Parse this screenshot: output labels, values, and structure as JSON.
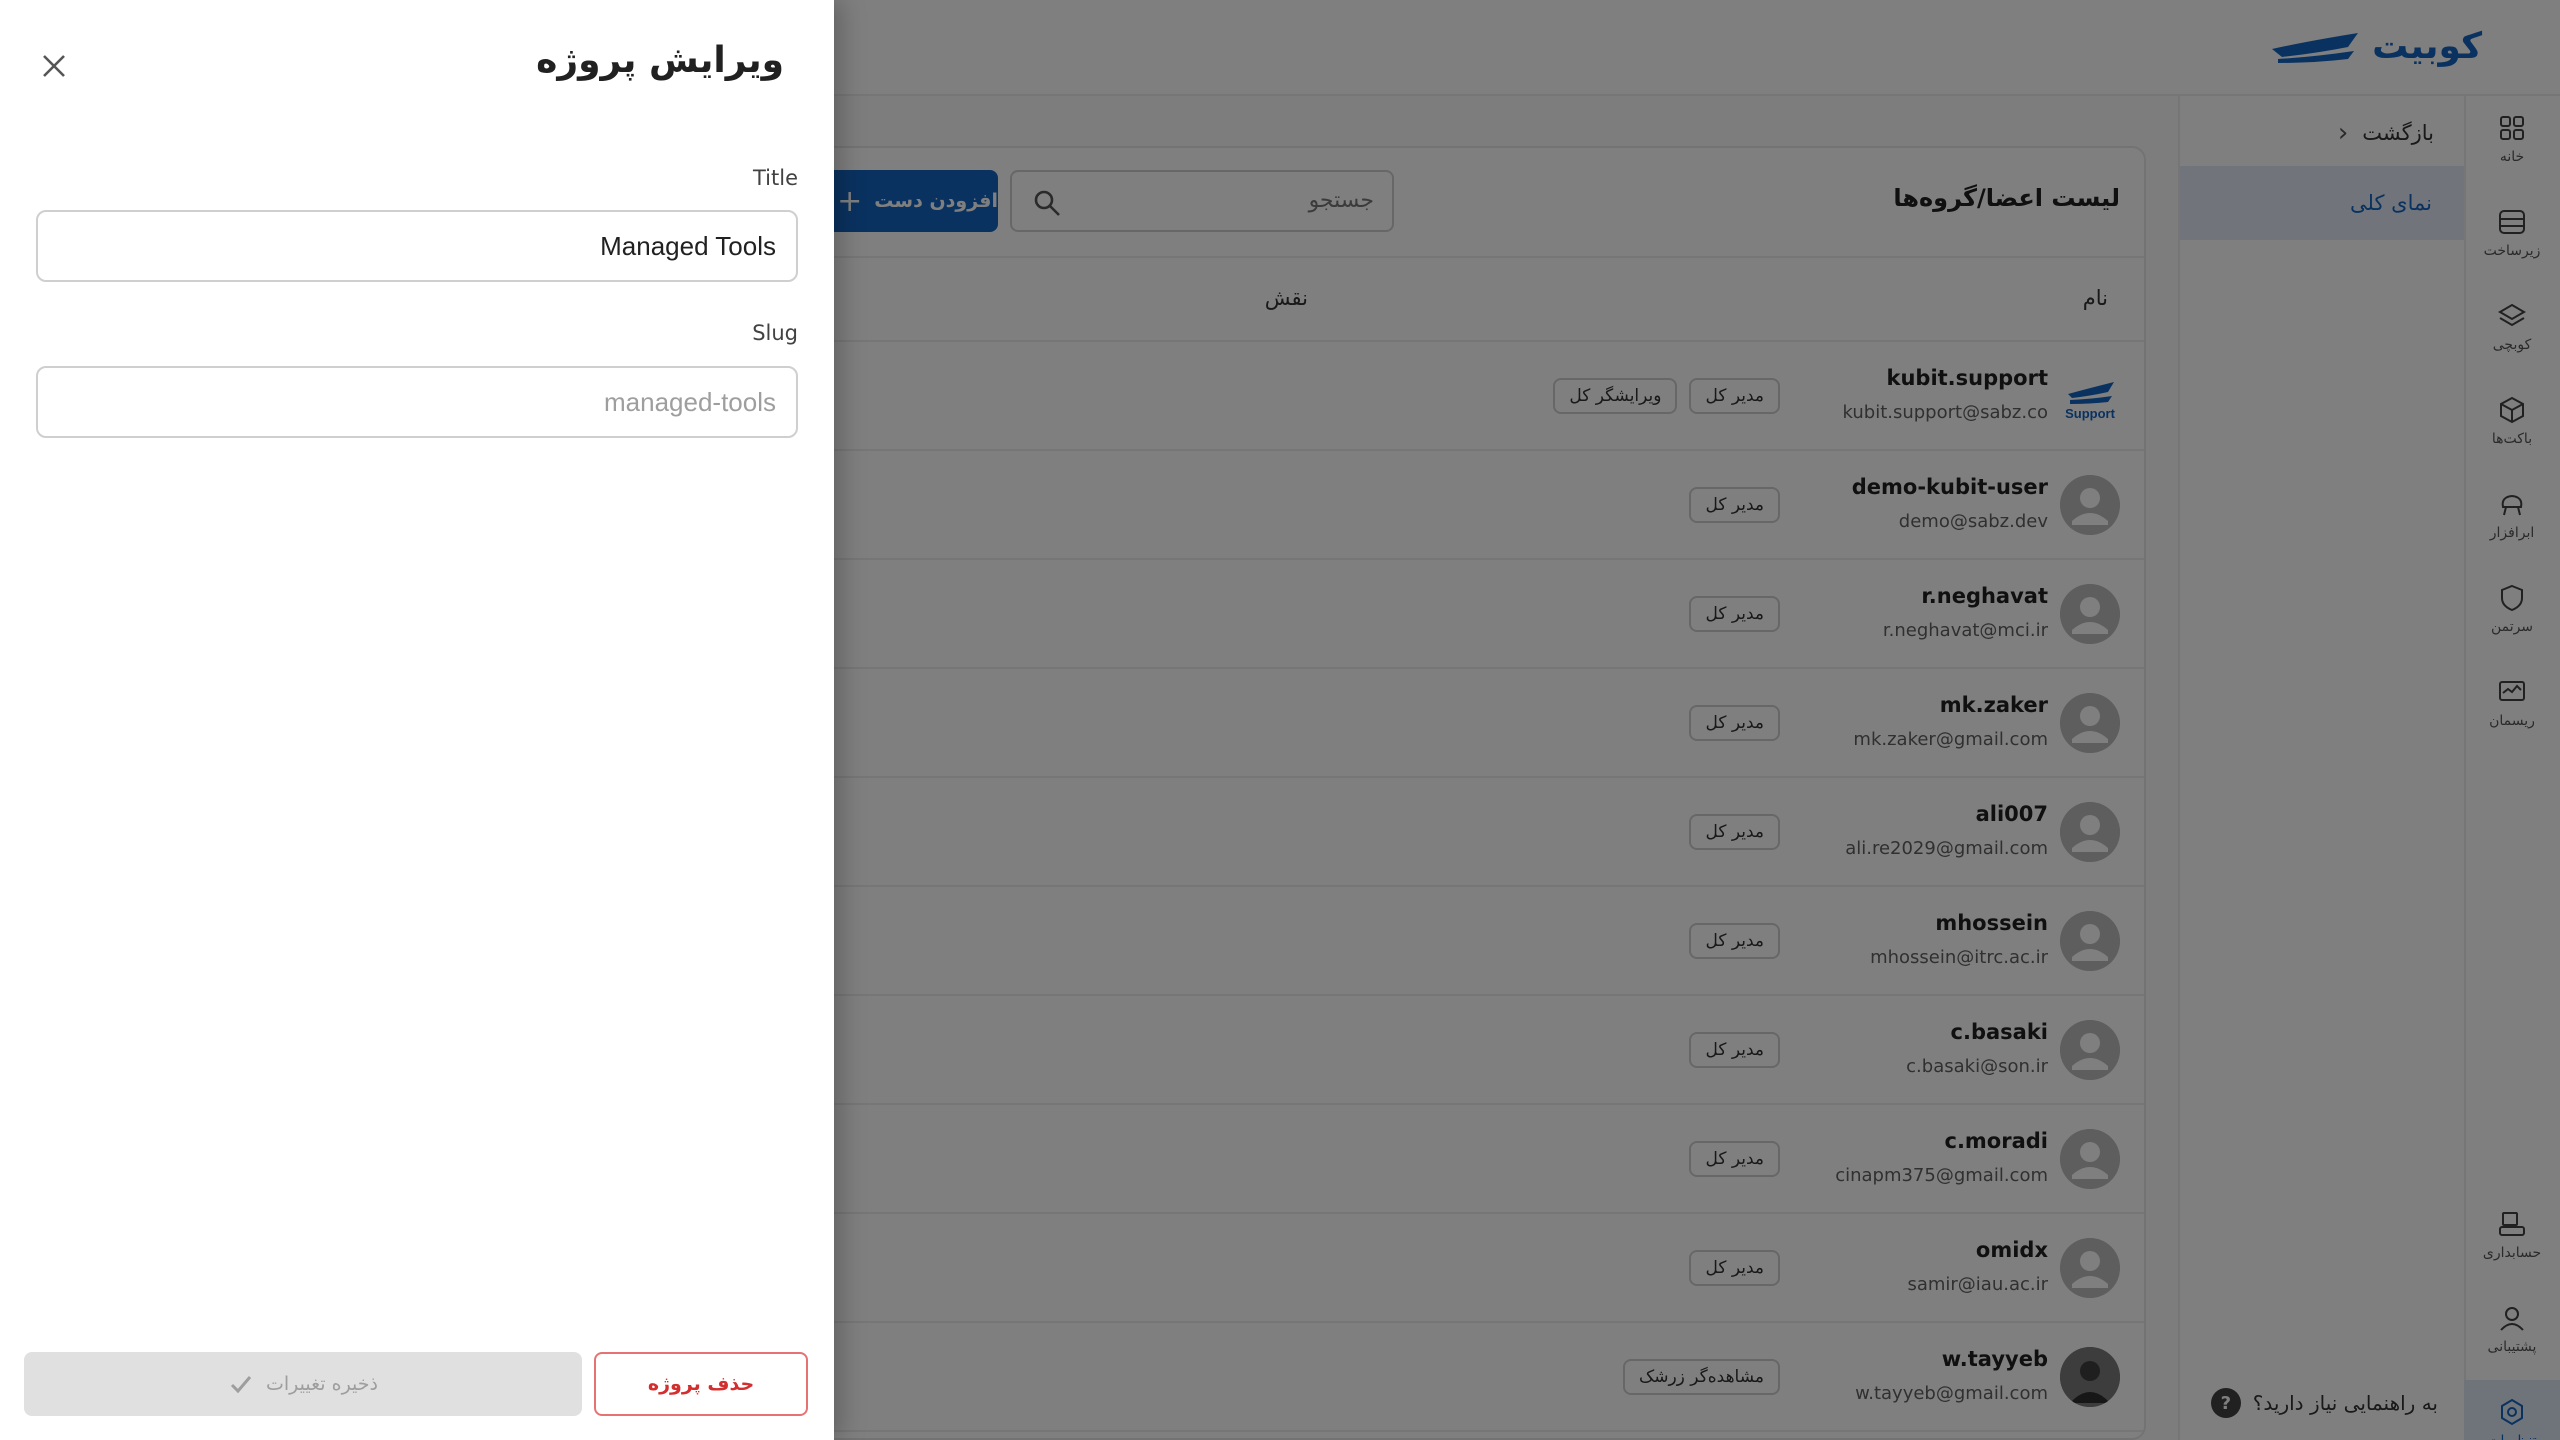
{
  "app": {
    "logo_text": "کوبیت",
    "brand_color": "#1565c0"
  },
  "rail": {
    "items": [
      {
        "label": "خانه",
        "icon": "grid-icon"
      },
      {
        "label": "زیرساخت",
        "icon": "server-icon"
      },
      {
        "label": "کوبچی",
        "icon": "layers-icon"
      },
      {
        "label": "باکت‌ها",
        "icon": "box-icon"
      },
      {
        "label": "ابرافزار",
        "icon": "cloud-tool-icon"
      },
      {
        "label": "سرتمن",
        "icon": "shield-icon"
      },
      {
        "label": "ریسمان",
        "icon": "monitor-icon"
      },
      {
        "label": "حسابداری",
        "icon": "accounting-icon"
      },
      {
        "label": "پشتیبانی",
        "icon": "support-agent-icon"
      },
      {
        "label": "تنظیمات",
        "icon": "settings-icon"
      }
    ]
  },
  "subnav": {
    "back_label": "بازگشت",
    "overview_label": "نمای کلی",
    "help_label": "به راهنمایی نیاز دارید؟",
    "help_icon": "?"
  },
  "members": {
    "title": "لیست اعضا/گروه‌ها",
    "search_placeholder": "جستجو",
    "add_label": "افزودن دست",
    "col_name": "نام",
    "col_role": "نقش",
    "rows": [
      {
        "name": "kubit.support",
        "email": "kubit.support@sabz.co",
        "roles": [
          "مدیر کل",
          "ویرایشگر کل"
        ],
        "avatar": "support"
      },
      {
        "name": "demo-kubit-user",
        "email": "demo@sabz.dev",
        "roles": [
          "مدیر کل"
        ],
        "avatar": "default"
      },
      {
        "name": "r.neghavat",
        "email": "r.neghavat@mci.ir",
        "roles": [
          "مدیر کل"
        ],
        "avatar": "default"
      },
      {
        "name": "mk.zaker",
        "email": "mk.zaker@gmail.com",
        "roles": [
          "مدیر کل"
        ],
        "avatar": "default"
      },
      {
        "name": "ali007",
        "email": "ali.re2029@gmail.com",
        "roles": [
          "مدیر کل"
        ],
        "avatar": "default"
      },
      {
        "name": "mhossein",
        "email": "mhossein@itrc.ac.ir",
        "roles": [
          "مدیر کل"
        ],
        "avatar": "default"
      },
      {
        "name": "c.basaki",
        "email": "c.basaki@son.ir",
        "roles": [
          "مدیر کل"
        ],
        "avatar": "default"
      },
      {
        "name": "c.moradi",
        "email": "cinapm375@gmail.com",
        "roles": [
          "مدیر کل"
        ],
        "avatar": "default"
      },
      {
        "name": "omidx",
        "email": "samir@iau.ac.ir",
        "roles": [
          "مدیر کل"
        ],
        "avatar": "default"
      },
      {
        "name": "w.tayyeb",
        "email": "w.tayyeb@gmail.com",
        "roles": [
          "مشاهده‌گر زرشک"
        ],
        "avatar": "photo"
      }
    ]
  },
  "drawer": {
    "title": "ویرایش پروژه",
    "title_label": "Title",
    "title_value": "Managed Tools",
    "slug_label": "Slug",
    "slug_placeholder": "managed-tools",
    "save_label": "ذخیره تغییرات",
    "delete_label": "حذف پروژه"
  }
}
